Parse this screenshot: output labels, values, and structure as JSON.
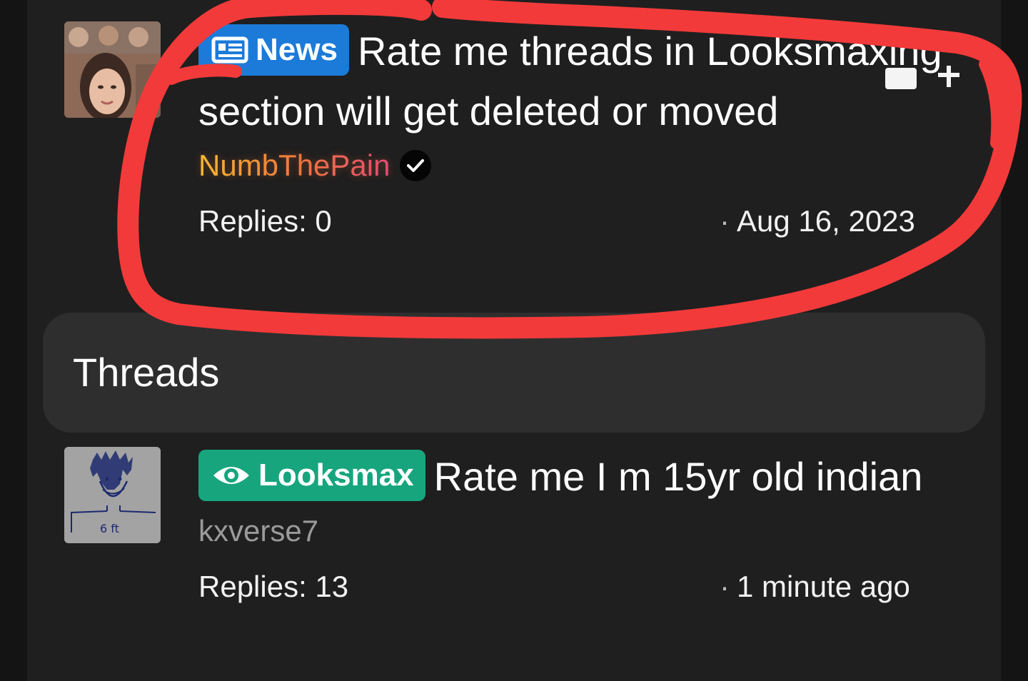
{
  "section_header": {
    "label": "Threads"
  },
  "pinned_thread": {
    "badge": {
      "label": "News",
      "icon": "newspaper-icon",
      "color": "#1c7bd9"
    },
    "title": "Rate me threads in Looksmaxing section will get deleted or moved",
    "author": "NumbThePain",
    "author_verified": true,
    "replies": "Replies: 0",
    "time": "Aug 16, 2023",
    "time_prefix": "·"
  },
  "threads": [
    {
      "badge": {
        "label": "Looksmax",
        "icon": "eye-icon",
        "color": "#17a57e"
      },
      "title": "Rate me I m 15yr old indian",
      "author": "kxverse7",
      "avatar_caption": "6 ft",
      "replies": "Replies: 13",
      "time": "1 minute ago",
      "time_prefix": "·"
    }
  ],
  "annotation": {
    "type": "red freehand circle",
    "color": "#f23a3a"
  }
}
